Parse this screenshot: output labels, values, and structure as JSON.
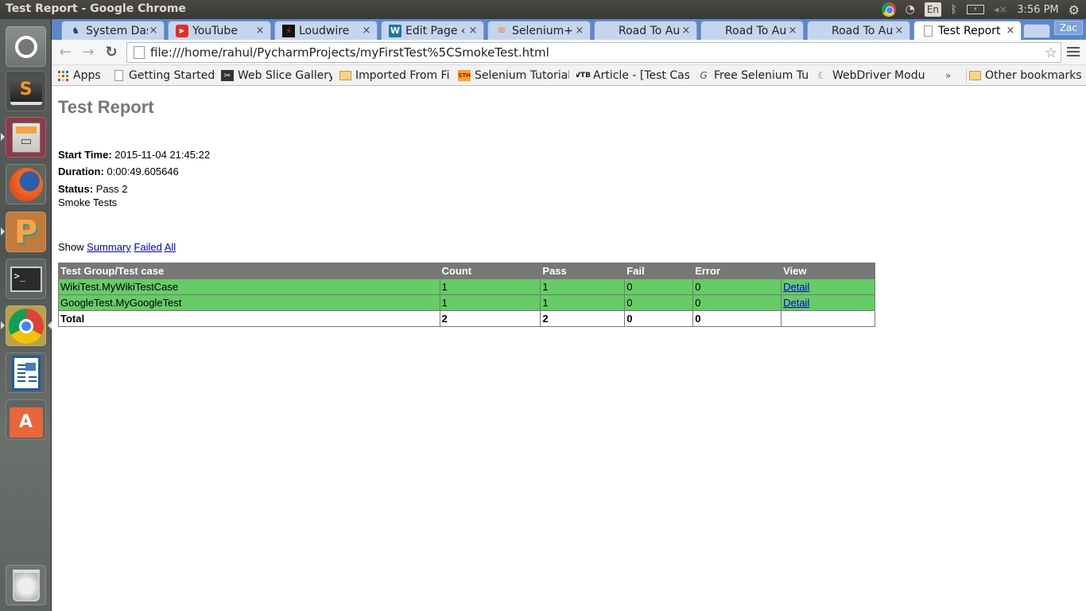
{
  "window_title": "Test Report - Google Chrome",
  "system_tray": {
    "keyboard_layout": "En",
    "battery_label": "⚡",
    "clock": "3:56 PM"
  },
  "launcher": {
    "apps": [
      {
        "name": "ubuntu-dash",
        "label": "Dash"
      },
      {
        "name": "sublime-text",
        "label": "S"
      },
      {
        "name": "files",
        "label": "Files"
      },
      {
        "name": "firefox",
        "label": "Firefox"
      },
      {
        "name": "pycharm",
        "label": "PyCharm"
      },
      {
        "name": "terminal",
        "label": ">_"
      },
      {
        "name": "chrome",
        "label": "Chrome"
      },
      {
        "name": "libreoffice-writer",
        "label": "Writer"
      },
      {
        "name": "software-center",
        "label": "A"
      },
      {
        "name": "trash",
        "label": "Trash"
      }
    ]
  },
  "browser": {
    "tabs": [
      {
        "label": "System Das",
        "icon": "jenkins-icon",
        "active": false
      },
      {
        "label": "YouTube",
        "icon": "youtube-icon",
        "active": false
      },
      {
        "label": "Loudwire",
        "icon": "loudwire-icon",
        "active": false
      },
      {
        "label": "Edit Page ‹ S",
        "icon": "wordpress-icon",
        "active": false
      },
      {
        "label": "Selenium+p",
        "icon": "stackoverflow-icon",
        "active": false
      },
      {
        "label": "Road To Aut",
        "icon": "blank-icon",
        "active": false
      },
      {
        "label": "Road To Aut",
        "icon": "blank-icon",
        "active": false
      },
      {
        "label": "Road To Aut",
        "icon": "blank-icon",
        "active": false
      },
      {
        "label": "Test Report",
        "icon": "page-icon",
        "active": true
      }
    ],
    "close_glyph": "×",
    "profile_label": "Zac",
    "url": "file:///home/rahul/PycharmProjects/myFirstTest%5CSmokeTest.html",
    "bookmarks": [
      {
        "label": "Apps",
        "icon": "apps-icon"
      },
      {
        "label": "Getting Started",
        "icon": "page-icon"
      },
      {
        "label": "Web Slice Gallery",
        "icon": "webslice-icon"
      },
      {
        "label": "Imported From Fi",
        "icon": "folder-icon"
      },
      {
        "label": "Selenium Tutorial",
        "icon": "sth-icon"
      },
      {
        "label": "Article - [Test Cas",
        "icon": "vtb-icon"
      },
      {
        "label": "Free Selenium Tut",
        "icon": "guru-icon"
      },
      {
        "label": "WebDriver Modu",
        "icon": "webdriver-icon"
      }
    ],
    "bookmarks_overflow": "»",
    "other_bookmarks": "Other bookmarks"
  },
  "report": {
    "title": "Test Report",
    "start_time_label": "Start Time:",
    "start_time": "2015-11-04 21:45:22",
    "duration_label": "Duration:",
    "duration": "0:00:49.605646",
    "status_label": "Status:",
    "status": "Pass 2",
    "description": "Smoke Tests",
    "show_label": "Show",
    "filters": [
      "Summary",
      "Failed",
      "All"
    ],
    "table": {
      "headers": [
        "Test Group/Test case",
        "Count",
        "Pass",
        "Fail",
        "Error",
        "View"
      ],
      "rows": [
        {
          "name": "WikiTest.MyWikiTestCase",
          "count": "1",
          "pass": "1",
          "fail": "0",
          "error": "0",
          "view": "Detail"
        },
        {
          "name": "GoogleTest.MyGoogleTest",
          "count": "1",
          "pass": "1",
          "fail": "0",
          "error": "0",
          "view": "Detail"
        }
      ],
      "total": {
        "name": "Total",
        "count": "2",
        "pass": "2",
        "fail": "0",
        "error": "0",
        "view": ""
      }
    },
    "colors": {
      "pass_row": "#66cc66",
      "header_row": "#777777",
      "title": "#777777"
    }
  }
}
